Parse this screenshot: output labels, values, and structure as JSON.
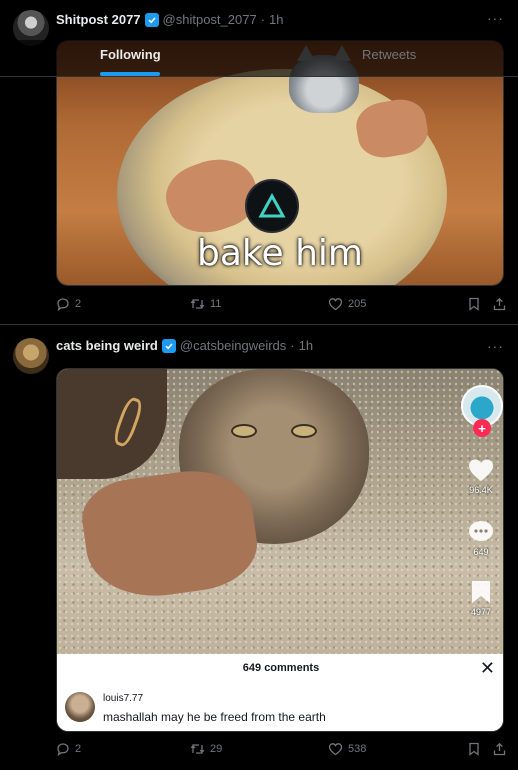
{
  "tabs": {
    "following": "Following",
    "retweets": "Retweets"
  },
  "tweets": [
    {
      "display_name": "Shitpost 2077",
      "handle": "@shitpost_2077",
      "separator": "·",
      "time": "1h",
      "more": "···",
      "media_caption": "bake him",
      "replies": "2",
      "retweets": "11",
      "likes": "205"
    },
    {
      "display_name": "cats being weird",
      "handle": "@catsbeingweirds",
      "separator": "·",
      "time": "1h",
      "more": "···",
      "video": {
        "likes": "96.4K",
        "comments": "649",
        "saves": "4977",
        "follow_plus": "+",
        "comments_header": "649 comments",
        "close": "✕",
        "comment_user": "louis7.77",
        "comment_text": "mashallah may he be freed from the earth"
      },
      "replies": "2",
      "retweets": "29",
      "likes": "538"
    }
  ],
  "icons": [
    "verified-badge-icon",
    "reply-icon",
    "retweet-icon",
    "like-icon",
    "bookmark-icon",
    "share-icon",
    "more-icon",
    "playstation-triangle-icon"
  ],
  "colors": {
    "accent": "#1d9bf0",
    "background": "#000000",
    "muted": "#71767b",
    "tiktok_red": "#fe2c55"
  }
}
